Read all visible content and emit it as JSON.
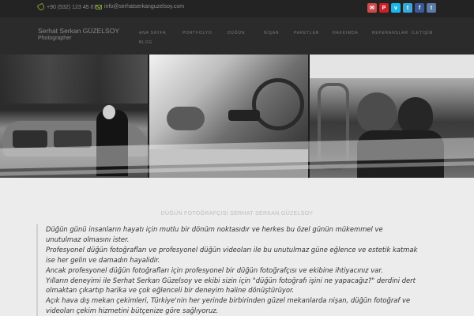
{
  "topbar": {
    "phone": "+90 (532) 123 45 67",
    "email": "info@serhatserkanguzelsoy.com",
    "socials": [
      {
        "icon": "mail-icon",
        "glyph": "✉",
        "color": "#cf4a4a"
      },
      {
        "icon": "pinterest-icon",
        "glyph": "P",
        "color": "#cb2027"
      },
      {
        "icon": "vimeo-icon",
        "glyph": "v",
        "color": "#1ab7ea"
      },
      {
        "icon": "twitter-icon",
        "glyph": "t",
        "color": "#3aa8db"
      },
      {
        "icon": "facebook-icon",
        "glyph": "f",
        "color": "#3b5998"
      },
      {
        "icon": "tumblr-icon",
        "glyph": "t",
        "color": "#5a7ca8"
      }
    ]
  },
  "brand": {
    "name": "Serhat Serkan GÜZELSOY",
    "subtitle": "Photographer"
  },
  "nav": {
    "items": [
      "ANA SAYFA",
      "PORTFOLYO",
      "DÜĞÜN",
      "NİŞAN",
      "PAKETLER",
      "HAKKIMDA",
      "REFERANSLAR",
      "BLOG",
      "İLETİŞİM"
    ]
  },
  "content": {
    "section_title": "DÜĞÜN FOTOĞRAFÇISI SERHAT SERKAN GÜZELSOY",
    "lines": [
      "Düğün günü insanların hayatı için mutlu bir dönüm noktasıdır ve herkes bu özel günün mükemmel ve",
      "unutulmaz olmasını ister.",
      "Profesyonel düğün fotoğrafları ve profesyonel düğün videoları ile bu unutulmaz güne eğlence ve estetik katmak",
      "ise her gelin ve damadın hayalidir.",
      "Ancak profesyonel düğün fotoğrafları için profesyonel bir düğün fotoğrafçısı ve ekibine ihtiyacınız var.",
      "Yılların deneyimi ile Serhat Serkan Güzelsoy ve ekibi sizin için \"düğün fotoğrafı işini ne yapacağız?\" derdini dert",
      "olmaktan çıkartıp harika ve çok eğlenceli bir deneyim haline dönüştürüyor.",
      "Açık hava dış mekan çekimleri, Türkiye'nin her yerinde birbirinden güzel mekanlarda nişan, düğün fotoğraf ve",
      "videoları çekim hizmetini bütçenize göre sağlıyoruz."
    ]
  }
}
